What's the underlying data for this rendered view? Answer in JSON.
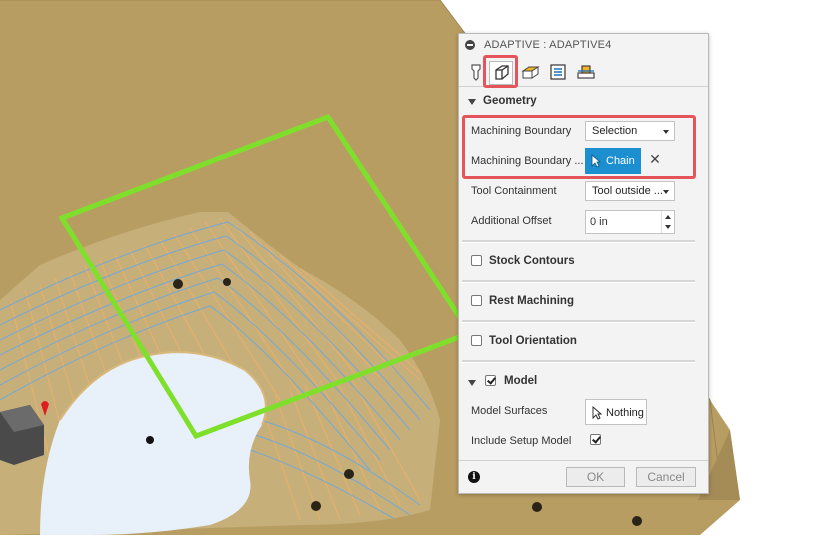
{
  "dialog": {
    "title": "ADAPTIVE : ADAPTIVE4",
    "tabs": [
      {
        "icon": "tool-icon"
      },
      {
        "icon": "geometry-icon",
        "active": true
      },
      {
        "icon": "heights-icon"
      },
      {
        "icon": "passes-icon"
      },
      {
        "icon": "linking-icon"
      }
    ],
    "geometry": {
      "title": "Geometry",
      "machining_boundary_label": "Machining Boundary",
      "machining_boundary_value": "Selection",
      "machining_boundary_sel_label": "Machining Boundary ...",
      "chain_label": "Chain",
      "clear_symbol": "✕",
      "tool_containment_label": "Tool Containment",
      "tool_containment_value": "Tool outside ...",
      "additional_offset_label": "Additional Offset",
      "additional_offset_value": "0 in"
    },
    "stock_contours": {
      "title": "Stock Contours",
      "checked": false
    },
    "rest_machining": {
      "title": "Rest Machining",
      "checked": false
    },
    "tool_orientation": {
      "title": "Tool Orientation",
      "checked": false
    },
    "model": {
      "title": "Model",
      "checked": true,
      "model_surfaces_label": "Model Surfaces",
      "model_surfaces_value": "Nothing",
      "include_setup_label": "Include Setup Model",
      "include_setup_checked": true
    },
    "info_symbol": "i",
    "ok_label": "OK",
    "cancel_label": "Cancel"
  },
  "colors": {
    "part_tan": "#b89d62",
    "boundary_green": "#7fe02c",
    "toolpath_orange": "#f0b068",
    "toolpath_blue": "#6aa8e0",
    "highlight_red": "#e5545a",
    "selected_blue": "#1b8fd0"
  }
}
